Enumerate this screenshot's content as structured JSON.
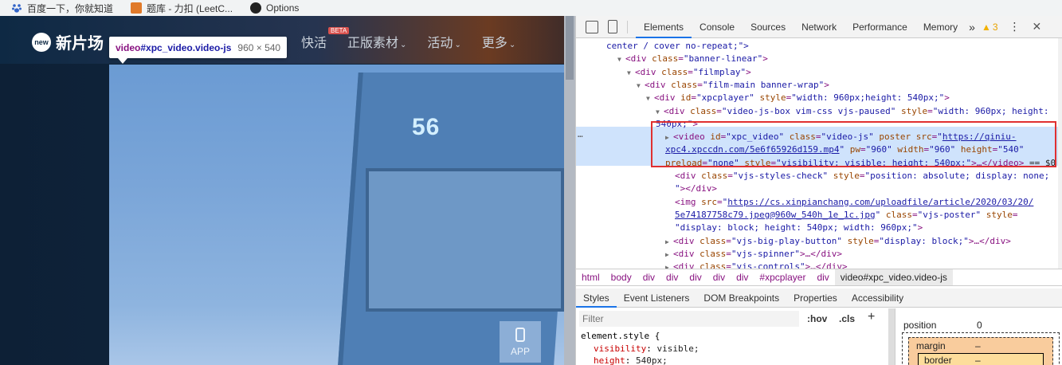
{
  "bookmarks": [
    {
      "label": "百度一下，你就知道",
      "icon": "paw-icon"
    },
    {
      "label": "题库 - 力扣 (LeetC...",
      "icon": "leetcode-icon"
    },
    {
      "label": "Options",
      "icon": "github-icon"
    }
  ],
  "site": {
    "logo_badge": "new",
    "logo_text": "新片场",
    "nav": [
      {
        "label": "快活",
        "beta": "BETA"
      },
      {
        "label": "正版素材",
        "chevron": "⌄"
      },
      {
        "label": "活动",
        "chevron": "⌄"
      },
      {
        "label": "更多",
        "chevron": "⌄"
      }
    ],
    "video_number": "56",
    "app_label": "APP"
  },
  "tooltip": {
    "tag": "video",
    "selector": "#xpc_video.video-js",
    "size": "960 × 540"
  },
  "devtools": {
    "tabs": [
      "Elements",
      "Console",
      "Sources",
      "Network",
      "Performance",
      "Memory"
    ],
    "active_tab": "Elements",
    "more": "»",
    "warning_count": "3",
    "kebab": "⋮",
    "close": "✕",
    "ellipsis": "…",
    "dom_lines": [
      {
        "indent": 38,
        "triangle": "",
        "segments": [
          [
            "val",
            "center / cover no-repeat;\">"
          ]
        ]
      },
      {
        "indent": 52,
        "triangle": "open",
        "segments": [
          [
            "tag",
            "<div "
          ],
          [
            "attr",
            "class"
          ],
          [
            "tag",
            "="
          ],
          [
            "val",
            "\"banner-linear\""
          ],
          [
            "tag",
            ">"
          ]
        ]
      },
      {
        "indent": 64,
        "triangle": "open",
        "segments": [
          [
            "tag",
            "<div "
          ],
          [
            "attr",
            "class"
          ],
          [
            "tag",
            "="
          ],
          [
            "val",
            "\"filmplay\""
          ],
          [
            "tag",
            ">"
          ]
        ]
      },
      {
        "indent": 76,
        "triangle": "open",
        "segments": [
          [
            "tag",
            "<div "
          ],
          [
            "attr",
            "class"
          ],
          [
            "tag",
            "="
          ],
          [
            "val",
            "\"film-main banner-wrap\""
          ],
          [
            "tag",
            ">"
          ]
        ]
      },
      {
        "indent": 88,
        "triangle": "open",
        "segments": [
          [
            "tag",
            "<div "
          ],
          [
            "attr",
            "id"
          ],
          [
            "tag",
            "="
          ],
          [
            "val",
            "\"xpcplayer\""
          ],
          [
            "tag",
            " "
          ],
          [
            "attr",
            "style"
          ],
          [
            "tag",
            "="
          ],
          [
            "val",
            "\"width: 960px;height: 540px;\""
          ],
          [
            "tag",
            ">"
          ]
        ]
      },
      {
        "indent": 100,
        "triangle": "open",
        "segments": [
          [
            "tag",
            "<div "
          ],
          [
            "attr",
            "class"
          ],
          [
            "tag",
            "="
          ],
          [
            "val",
            "\"video-js-box vim-css vjs-paused\""
          ],
          [
            "tag",
            " "
          ],
          [
            "attr",
            "style"
          ],
          [
            "tag",
            "="
          ],
          [
            "val",
            "\"width: 960px; height:"
          ]
        ]
      },
      {
        "indent": 100,
        "triangle": "",
        "segments": [
          [
            "val",
            "540px;\""
          ],
          [
            "tag",
            ">"
          ]
        ]
      },
      {
        "indent": 112,
        "triangle": "closed",
        "segments": [
          [
            "tag",
            "<video "
          ],
          [
            "attr",
            "id"
          ],
          [
            "tag",
            "="
          ],
          [
            "val",
            "\"xpc_video\""
          ],
          [
            "tag",
            " "
          ],
          [
            "attr",
            "class"
          ],
          [
            "tag",
            "="
          ],
          [
            "val",
            "\"video-js\""
          ],
          [
            "tag",
            " "
          ],
          [
            "attr",
            "poster"
          ],
          [
            "tag",
            " "
          ],
          [
            "attr",
            "src"
          ],
          [
            "tag",
            "="
          ],
          [
            "val",
            "\""
          ],
          [
            "link",
            "https://qiniu-"
          ]
        ]
      },
      {
        "indent": 112,
        "triangle": "",
        "segments": [
          [
            "link",
            "xpc4.xpccdn.com/5e6f65926d159.mp4"
          ],
          [
            "val",
            "\""
          ],
          [
            "tag",
            " "
          ],
          [
            "attr",
            "pw"
          ],
          [
            "tag",
            "="
          ],
          [
            "val",
            "\"960\""
          ],
          [
            "tag",
            " "
          ],
          [
            "attr",
            "width"
          ],
          [
            "tag",
            "="
          ],
          [
            "val",
            "\"960\""
          ],
          [
            "tag",
            " "
          ],
          [
            "attr",
            "height"
          ],
          [
            "tag",
            "="
          ],
          [
            "val",
            "\"540\""
          ]
        ]
      },
      {
        "indent": 112,
        "triangle": "",
        "segments": [
          [
            "attr",
            "preload"
          ],
          [
            "tag",
            "="
          ],
          [
            "val",
            "\"none\""
          ],
          [
            "tag",
            " "
          ],
          [
            "attr",
            "style"
          ],
          [
            "tag",
            "="
          ],
          [
            "val",
            "\"visibility: visible; height: 540px;\""
          ],
          [
            "tag",
            ">…</video>"
          ],
          [
            "plain",
            " == $0"
          ]
        ]
      },
      {
        "indent": 124,
        "triangle": "",
        "segments": [
          [
            "tag",
            "<div "
          ],
          [
            "attr",
            "class"
          ],
          [
            "tag",
            "="
          ],
          [
            "val",
            "\"vjs-styles-check\""
          ],
          [
            "tag",
            " "
          ],
          [
            "attr",
            "style"
          ],
          [
            "tag",
            "="
          ],
          [
            "val",
            "\"position: absolute; display: none;"
          ]
        ]
      },
      {
        "indent": 124,
        "triangle": "",
        "segments": [
          [
            "val",
            "\""
          ],
          [
            "tag",
            "></div>"
          ]
        ]
      },
      {
        "indent": 124,
        "triangle": "",
        "segments": [
          [
            "tag",
            "<img "
          ],
          [
            "attr",
            "src"
          ],
          [
            "tag",
            "="
          ],
          [
            "val",
            "\""
          ],
          [
            "link",
            "https://cs.xinpianchang.com/uploadfile/article/2020/03/20/"
          ]
        ]
      },
      {
        "indent": 124,
        "triangle": "",
        "segments": [
          [
            "link",
            "5e74187758c79.jpeg@960w_540h_1e_1c.jpg"
          ],
          [
            "val",
            "\""
          ],
          [
            "tag",
            " "
          ],
          [
            "attr",
            "class"
          ],
          [
            "tag",
            "="
          ],
          [
            "val",
            "\"vjs-poster\""
          ],
          [
            "tag",
            " "
          ],
          [
            "attr",
            "style"
          ],
          [
            "tag",
            "="
          ]
        ]
      },
      {
        "indent": 124,
        "triangle": "",
        "segments": [
          [
            "val",
            "\"display: block; height: 540px; width: 960px;\""
          ],
          [
            "tag",
            ">"
          ]
        ]
      },
      {
        "indent": 112,
        "triangle": "closed",
        "segments": [
          [
            "tag",
            "<div "
          ],
          [
            "attr",
            "class"
          ],
          [
            "tag",
            "="
          ],
          [
            "val",
            "\"vjs-big-play-button\""
          ],
          [
            "tag",
            " "
          ],
          [
            "attr",
            "style"
          ],
          [
            "tag",
            "="
          ],
          [
            "val",
            "\"display: block;\""
          ],
          [
            "tag",
            ">…</div>"
          ]
        ]
      },
      {
        "indent": 112,
        "triangle": "closed",
        "segments": [
          [
            "tag",
            "<div "
          ],
          [
            "attr",
            "class"
          ],
          [
            "tag",
            "="
          ],
          [
            "val",
            "\"vjs-spinner\""
          ],
          [
            "tag",
            ">…</div>"
          ]
        ]
      },
      {
        "indent": 112,
        "triangle": "closed",
        "segments": [
          [
            "tag",
            "<div "
          ],
          [
            "attr",
            "class"
          ],
          [
            "tag",
            "="
          ],
          [
            "val",
            "\"vjs-controls\""
          ],
          [
            "tag",
            ">…</div>"
          ]
        ]
      }
    ],
    "breadcrumb": [
      "html",
      "body",
      "div",
      "div",
      "div",
      "div",
      "div",
      "#xpcplayer",
      "div",
      "video#xpc_video.video-js"
    ],
    "sub_tabs": [
      "Styles",
      "Event Listeners",
      "DOM Breakpoints",
      "Properties",
      "Accessibility"
    ],
    "active_sub_tab": "Styles",
    "filter_placeholder": "Filter",
    "hov": ":hov",
    "cls": ".cls",
    "plus": "+",
    "style_rule": "element.style {",
    "style_props": [
      {
        "prop": "visibility",
        "value": "visible;"
      },
      {
        "prop": "height",
        "value": "540px;"
      }
    ],
    "box_model": {
      "position_label": "position",
      "position_value": "0",
      "margin_label": "margin",
      "margin_value": "–",
      "border_label": "border",
      "border_value": "–"
    }
  }
}
